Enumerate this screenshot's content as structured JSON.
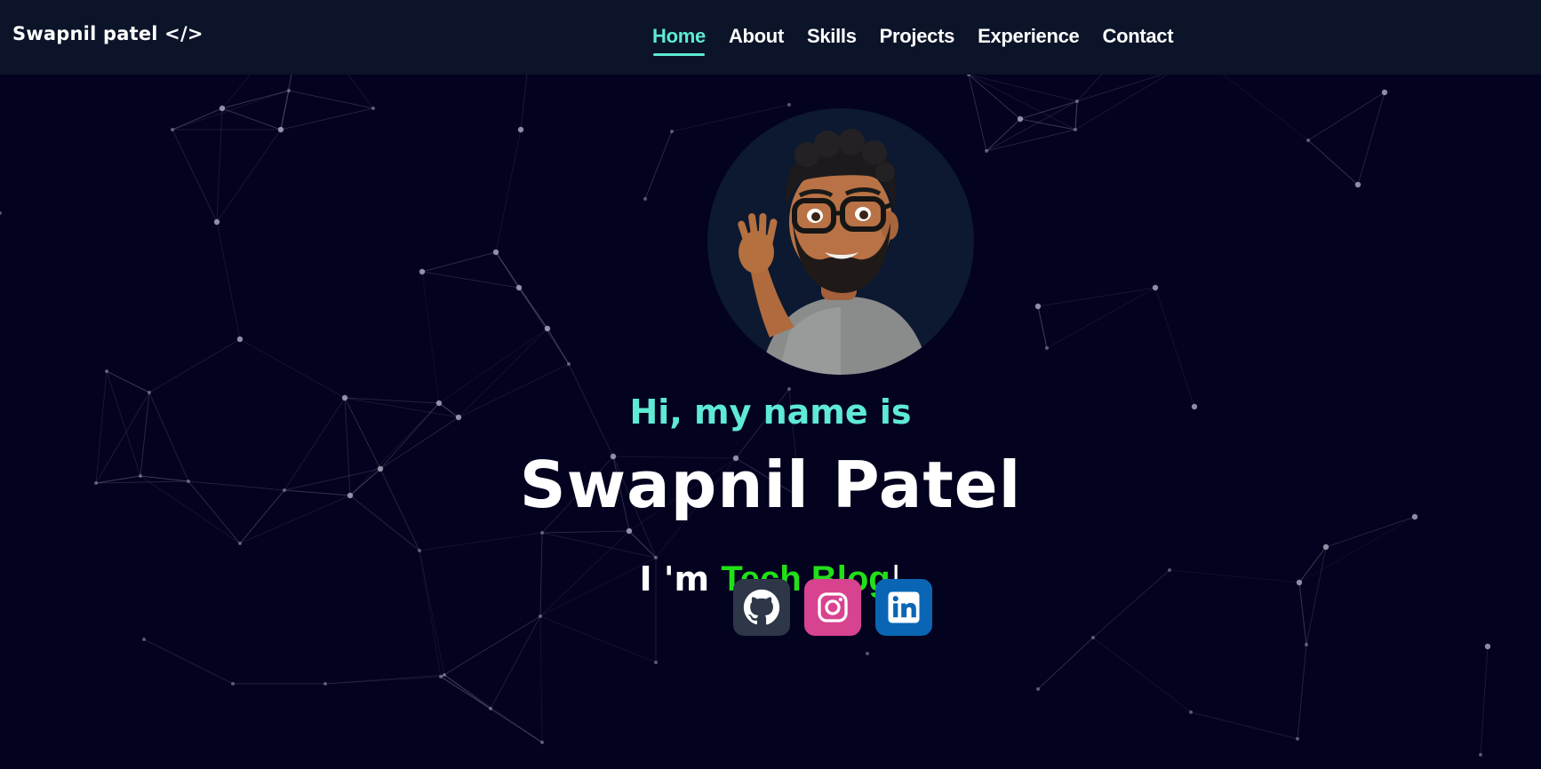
{
  "navbar": {
    "logo": "Swapnil patel </>",
    "links": [
      {
        "label": "Home",
        "active": true
      },
      {
        "label": "About",
        "active": false
      },
      {
        "label": "Skills",
        "active": false
      },
      {
        "label": "Projects",
        "active": false
      },
      {
        "label": "Experience",
        "active": false
      },
      {
        "label": "Contact",
        "active": false
      }
    ]
  },
  "hero": {
    "avatar_icon": "memoji-waving-avatar",
    "greeting": "Hi, my name is",
    "name": "Swapnil Patel",
    "typing_prefix": "I 'm",
    "typing_role": "Tech Blog",
    "typing_cursor": "|"
  },
  "socials": [
    {
      "name": "github",
      "icon": "github-icon",
      "color": "#2d3748"
    },
    {
      "name": "instagram",
      "icon": "instagram-icon",
      "color": "#d8438f"
    },
    {
      "name": "linkedin",
      "icon": "linkedin-icon",
      "color": "#0a66b5"
    }
  ],
  "colors": {
    "background": "#03021f",
    "navbar": "#0b1428",
    "accent": "#5eead4",
    "role_green": "#22e018"
  }
}
